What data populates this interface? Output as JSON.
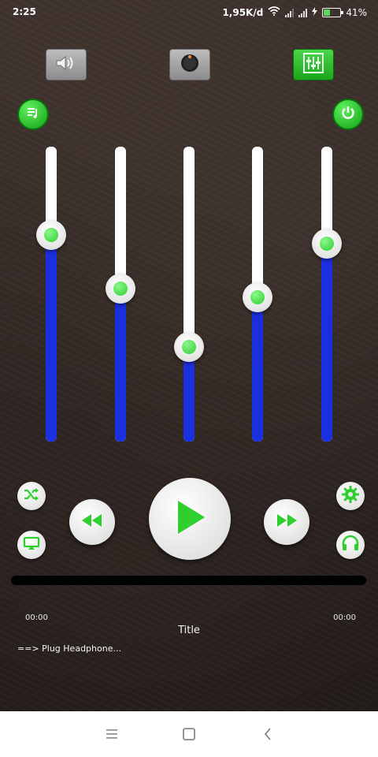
{
  "status_bar": {
    "time": "2:25",
    "network_speed": "1,95K/d",
    "battery_percent": "41%",
    "icons": [
      "wifi-icon",
      "signal-icon",
      "signal-icon",
      "charging-bolt-icon",
      "battery-icon"
    ]
  },
  "toolbar": {
    "buttons": [
      "speaker-icon",
      "knob-icon",
      "equalizer-icon"
    ],
    "selected": "equalizer-icon"
  },
  "side_buttons": {
    "left": "playlist-icon",
    "right": "power-icon"
  },
  "equalizer": {
    "bands": [
      {
        "value": 0.7
      },
      {
        "value": 0.52
      },
      {
        "value": 0.32
      },
      {
        "value": 0.49
      },
      {
        "value": 0.67
      }
    ]
  },
  "controls": {
    "shuffle": "shuffle-icon",
    "repeat": "repeat-icon",
    "rewind": "rewind-icon",
    "play": "play-icon",
    "forward": "fast-forward-icon",
    "settings": "settings-gear-icon",
    "headphones": "headphones-icon"
  },
  "player": {
    "progress": 0,
    "elapsed": "00:00",
    "duration": "00:00",
    "title": "Title",
    "hint": "==> Plug Headphone..."
  },
  "colors": {
    "accent_green": "#2fcf2f",
    "slider_blue": "#1a2fe0",
    "background": "#2c2421"
  },
  "nav_bar": {
    "icons": [
      "menu-icon",
      "home-icon",
      "back-icon"
    ]
  }
}
